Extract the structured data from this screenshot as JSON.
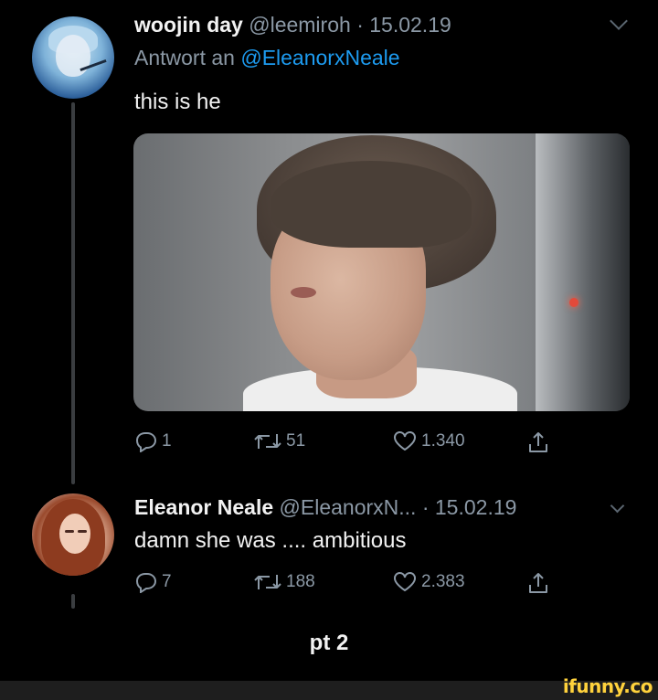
{
  "tweet1": {
    "name": "woojin day",
    "handle": "@leemiroh",
    "separator": "·",
    "date": "15.02.19",
    "reply_prefix": "Antwort an",
    "reply_to": "@EleanorxNeale",
    "text": "this is he",
    "replies": "1",
    "retweets": "51",
    "likes": "1.340"
  },
  "tweet2": {
    "name": "Eleanor Neale",
    "handle": "@EleanorxN...",
    "separator": "·",
    "date": "15.02.19",
    "text": "damn she was .... ambitious",
    "replies": "7",
    "retweets": "188",
    "likes": "2.383"
  },
  "caption": "pt 2",
  "watermark": "ifunny.co",
  "icons": [
    "reply-icon",
    "retweet-icon",
    "like-icon",
    "share-icon",
    "chevron-down-icon"
  ],
  "colors": {
    "background": "#000000",
    "muted": "#8b98a5",
    "link": "#1d9bf0",
    "watermark": "#ffd23c"
  }
}
